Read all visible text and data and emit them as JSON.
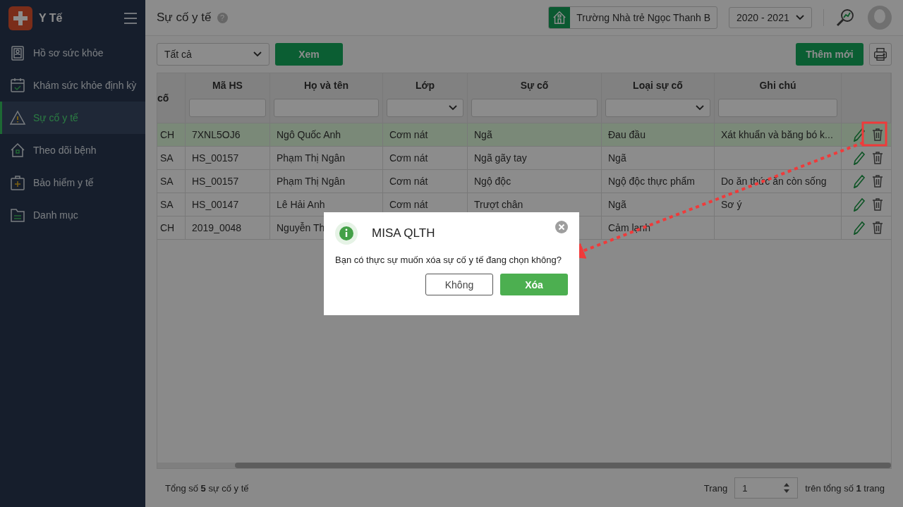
{
  "app": {
    "title": "Y Tế"
  },
  "sidebar": {
    "items": [
      {
        "label": "Hồ sơ sức khỏe",
        "selected": false
      },
      {
        "label": "Khám sức khỏe định kỳ",
        "selected": false
      },
      {
        "label": "Sự cố y tế",
        "selected": true
      },
      {
        "label": "Theo dõi bệnh",
        "selected": false
      },
      {
        "label": "Bảo hiểm y tế",
        "selected": false
      },
      {
        "label": "Danh mục",
        "selected": false
      }
    ]
  },
  "header": {
    "title": "Sự cố y tế",
    "help": "?",
    "school": "Trường Nhà trẻ Ngọc Thanh B",
    "year": "2020 - 2021"
  },
  "toolbar": {
    "filter": "Tất cả",
    "view_button": "Xem",
    "add_button": "Thêm mới"
  },
  "table": {
    "columns": [
      {
        "label": "cố",
        "kind": "none"
      },
      {
        "label": "Mã HS",
        "kind": "text"
      },
      {
        "label": "Họ và tên",
        "kind": "text"
      },
      {
        "label": "Lớp",
        "kind": "select"
      },
      {
        "label": "Sự cố",
        "kind": "text"
      },
      {
        "label": "Loại sự cố",
        "kind": "select"
      },
      {
        "label": "Ghi chú",
        "kind": "text"
      }
    ],
    "rows": [
      {
        "selected": true,
        "cells": [
          "CH",
          "7XNL5OJ6",
          "Ngô Quốc Anh",
          "Cơm nát",
          "Ngã",
          "Đau đầu",
          "Xát khuẩn và băng bó k..."
        ]
      },
      {
        "selected": false,
        "cells": [
          "SA",
          "HS_00157",
          "Phạm Thị Ngân",
          "Cơm nát",
          "Ngã gãy tay",
          "Ngã",
          null
        ]
      },
      {
        "selected": false,
        "cells": [
          "SA",
          "HS_00157",
          "Phạm Thị Ngân",
          "Cơm nát",
          "Ngộ độc",
          "Ngộ độc thực phẩm",
          "Do ăn thức ăn còn sống"
        ]
      },
      {
        "selected": false,
        "cells": [
          "SA",
          "HS_00147",
          "Lê Hải Anh",
          "Cơm nát",
          "Trượt chân",
          "Ngã",
          "Sơ ý"
        ]
      },
      {
        "selected": false,
        "cells": [
          "CH",
          "2019_0048",
          "Nguyễn Th",
          null,
          null,
          "Cảm lạnh",
          null
        ]
      }
    ]
  },
  "footer": {
    "total": "Tổng số **5** sự cố y tế",
    "page_label": "Trang",
    "page": "1",
    "page_total": "trên tổng số **1** trang"
  },
  "dialog": {
    "title": "MISA QLTH",
    "message": "Bạn có thực sự muốn xóa sự cố y tế đang chọn không?",
    "cancel": "Không",
    "confirm": "Xóa"
  }
}
